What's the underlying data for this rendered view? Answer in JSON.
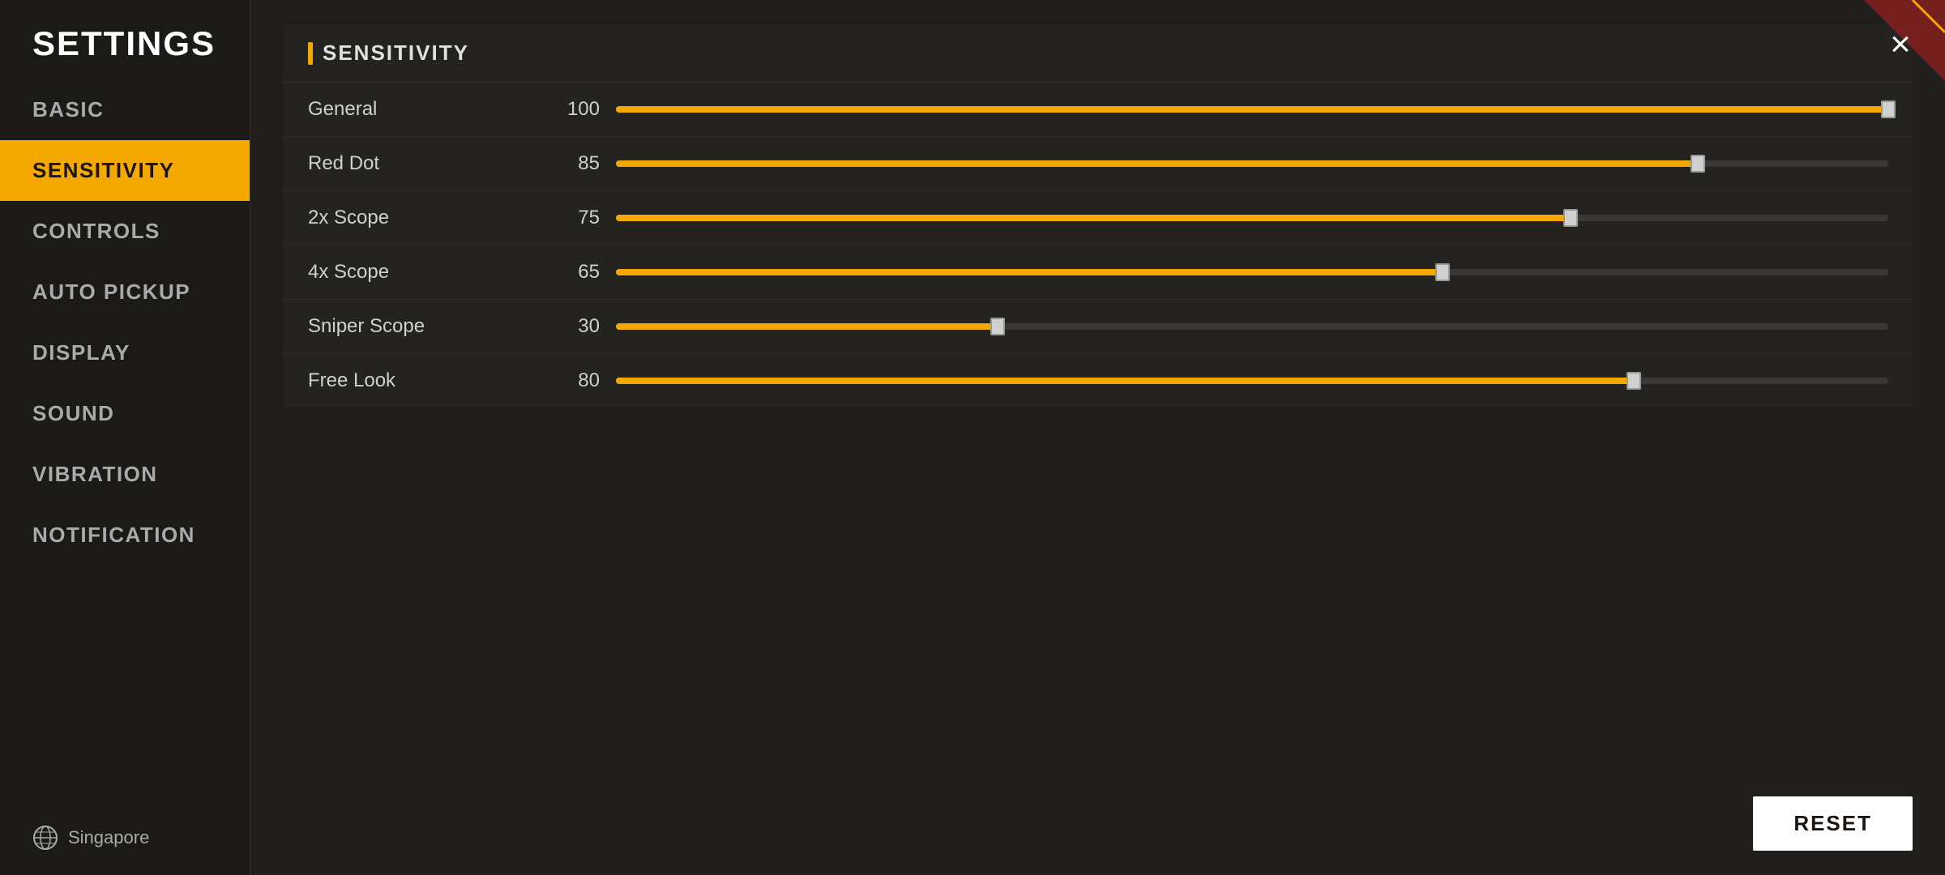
{
  "sidebar": {
    "title": "SETTINGS",
    "items": [
      {
        "id": "basic",
        "label": "BASIC",
        "active": false
      },
      {
        "id": "sensitivity",
        "label": "SENSITIVITY",
        "active": true
      },
      {
        "id": "controls",
        "label": "CONTROLS",
        "active": false
      },
      {
        "id": "auto-pickup",
        "label": "AUTO PICKUP",
        "active": false
      },
      {
        "id": "display",
        "label": "DISPLAY",
        "active": false
      },
      {
        "id": "sound",
        "label": "SOUND",
        "active": false
      },
      {
        "id": "vibration",
        "label": "VIBRATION",
        "active": false
      },
      {
        "id": "notification",
        "label": "NOTIFICATION",
        "active": false
      }
    ],
    "footer": {
      "region": "Singapore"
    }
  },
  "main": {
    "section_title": "SENSITIVITY",
    "sliders": [
      {
        "label": "General",
        "value": 100,
        "percent": 100
      },
      {
        "label": "Red Dot",
        "value": 85,
        "percent": 85
      },
      {
        "label": "2x Scope",
        "value": 75,
        "percent": 75
      },
      {
        "label": "4x Scope",
        "value": 65,
        "percent": 65
      },
      {
        "label": "Sniper Scope",
        "value": 30,
        "percent": 30
      },
      {
        "label": "Free Look",
        "value": 80,
        "percent": 80
      }
    ],
    "reset_label": "RESET"
  },
  "close_label": "×",
  "colors": {
    "accent": "#f5a800",
    "bg_sidebar": "#1c1a17",
    "bg_main": "#201e1a",
    "bg_panel": "#252320",
    "active_text": "#1a1510",
    "text_primary": "#d0d0d0",
    "text_muted": "#aaaaaa",
    "track_bg": "#3a3835"
  }
}
